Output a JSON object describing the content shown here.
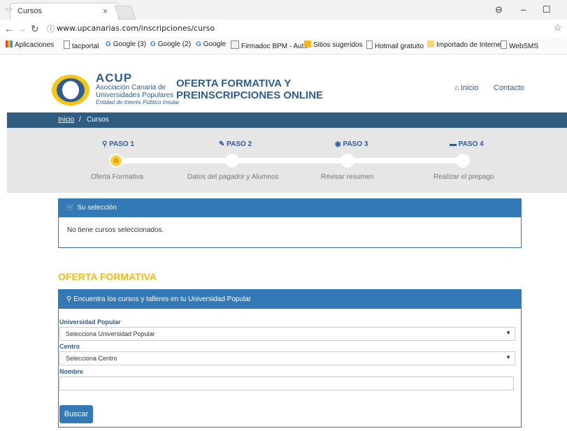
{
  "browser": {
    "tab_title": "Cursos",
    "tab_close": "×",
    "url": "www.upcanarias.com/inscripciones/curso",
    "window_controls": {
      "profile": "⊖",
      "minimize": "–",
      "maximize": "☐"
    },
    "bookmarks": [
      {
        "label": "Aplicaciones",
        "icon": "apps-grid-icon"
      },
      {
        "label": "tacportal",
        "icon": "page-icon"
      },
      {
        "label": "Google (3)",
        "icon": "google-icon"
      },
      {
        "label": "Google (2)",
        "icon": "google-icon"
      },
      {
        "label": "Google",
        "icon": "google-icon"
      },
      {
        "label": "Firmadoc BPM - Auto",
        "icon": "firmadoc-icon"
      },
      {
        "label": "Sitios sugeridos",
        "icon": "bing-icon"
      },
      {
        "label": "Hotmail gratuito",
        "icon": "page-icon"
      },
      {
        "label": "Importado de Interne",
        "icon": "folder-icon"
      },
      {
        "label": "WebSMS",
        "icon": "page-icon"
      }
    ]
  },
  "header": {
    "brand": "ACUP",
    "brand_line1": "Asociación Canaria de",
    "brand_line2": "Universidades Populares",
    "brand_line3": "Entidad de Interés Público Insular",
    "title_line1": "OFERTA FORMATIVA Y",
    "title_line2": "PREINSCRIPCIONES ONLINE",
    "nav": {
      "home": "Inicio",
      "contact": "Contacto"
    }
  },
  "breadcrumb": {
    "home": "Inicio",
    "separator": "/",
    "current": "Cursos"
  },
  "steps": [
    {
      "label": "PASO 1",
      "desc": "Oferta Formativa",
      "icon": "search-icon"
    },
    {
      "label": "PASO 2",
      "desc": "Datos del pagador y Alumnos",
      "icon": "pencil-icon"
    },
    {
      "label": "PASO 3",
      "desc": "Revisar resumen",
      "icon": "eye-icon"
    },
    {
      "label": "PASO 4",
      "desc": "Realizar el prepago",
      "icon": "credit-card-icon"
    }
  ],
  "selection": {
    "title": "Su selección",
    "empty": "No tiene cursos seleccionados."
  },
  "oferta": {
    "title": "OFERTA FORMATIVA",
    "panel_title": "Encuentra los cursos y talleres en tu Universidad Popular",
    "up_label": "Universidad Popular",
    "up_value": "Selecciona Universidad Popular",
    "centro_label": "Centro",
    "centro_value": "Selecciona Centro",
    "nombre_label": "Nombre",
    "nombre_value": "",
    "search_button": "Buscar"
  },
  "colors": {
    "primary": "#3379b7",
    "accent": "#f5b81a",
    "dark": "#2f5c7f"
  }
}
